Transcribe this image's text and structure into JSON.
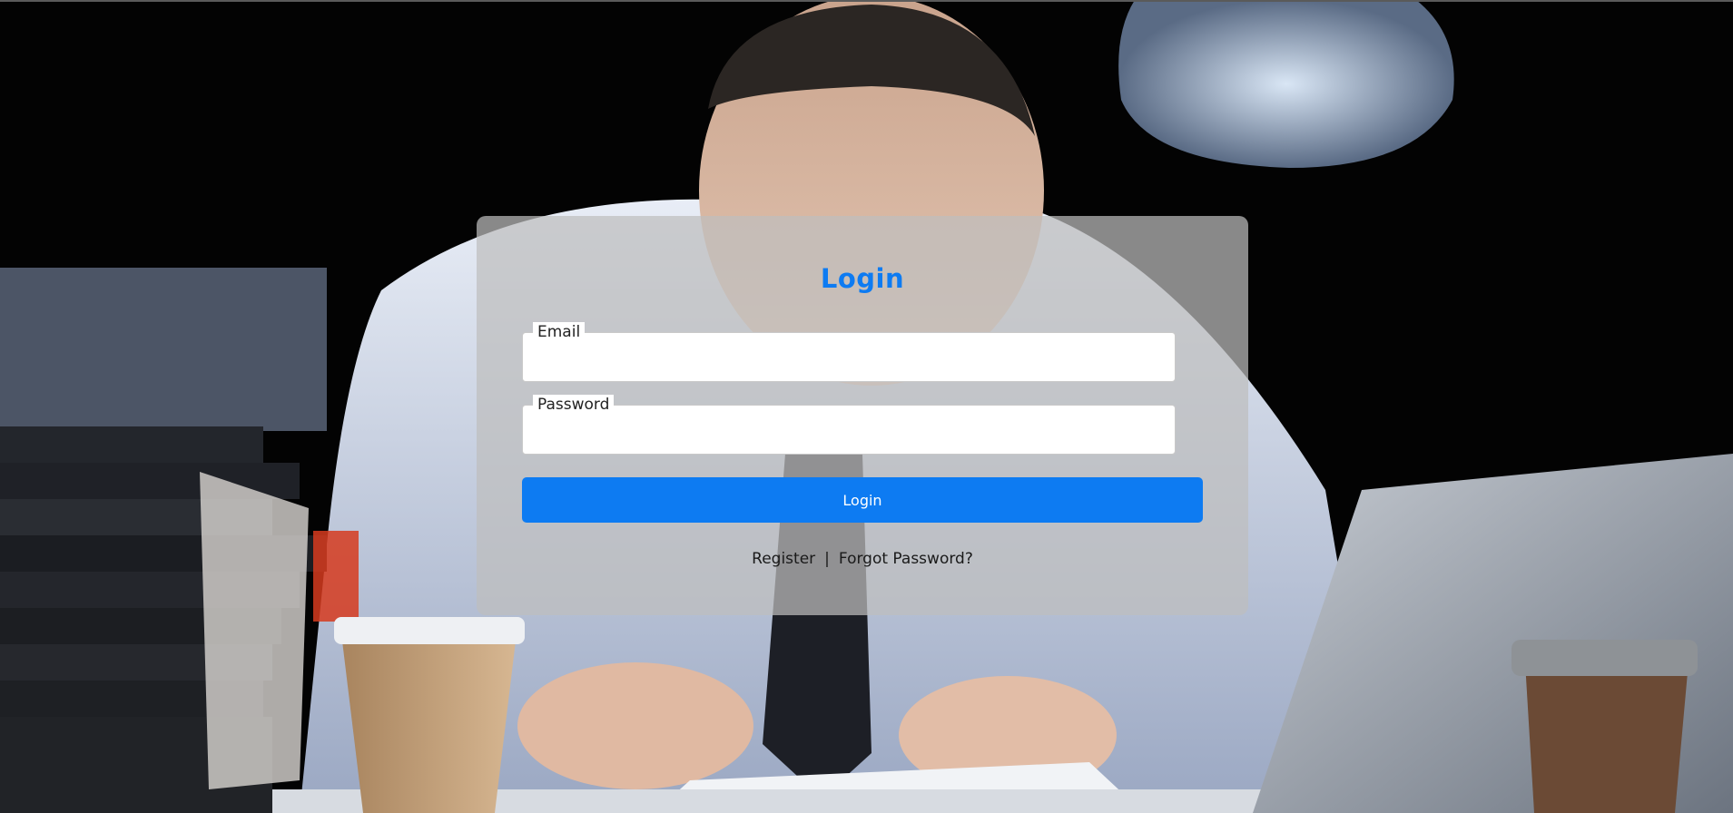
{
  "login": {
    "title": "Login",
    "email_label": "Email",
    "email_value": "",
    "password_label": "Password",
    "password_value": "",
    "submit_label": "Login",
    "register_link": "Register",
    "separator": "|",
    "forgot_link": "Forgot Password?"
  },
  "colors": {
    "accent": "#0d7bf2",
    "card_bg": "rgba(190,190,190,0.72)",
    "background": "#000000"
  }
}
